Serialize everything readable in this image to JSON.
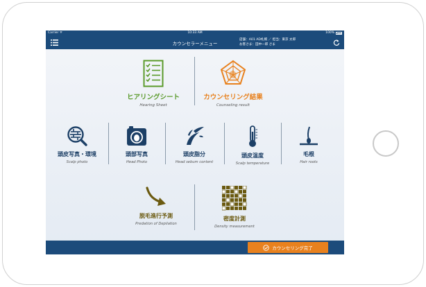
{
  "statusbar": {
    "carrier": "Carrier ᯤ",
    "time": "10:33 AM",
    "battery": "100%"
  },
  "navbar": {
    "title": "カウンセラーメニュー",
    "info_line1": "店舗：A01 AD札幌 ／ 担当：東京 太郎",
    "info_line2": "お客さま：田中一郎 さま"
  },
  "menu": {
    "hearing_sheet": {
      "jp": "ヒアリングシート",
      "en": "Hearing Sheet",
      "color": "#5a9a2a"
    },
    "counseling_result": {
      "jp": "カウンセリング結果",
      "en": "Counseling result",
      "color": "#e8811e"
    },
    "scalp_photo": {
      "jp": "頭皮写真・環境",
      "en": "Scalp photo"
    },
    "head_photo": {
      "jp": "頭部写真",
      "en": "Head Photo"
    },
    "head_sebum": {
      "jp": "頭皮脂分",
      "en": "Head sebum content"
    },
    "scalp_temperature": {
      "jp": "頭皮温度",
      "en": "Scalp temperature"
    },
    "hair_roots": {
      "jp": "毛根",
      "en": "Hair roots"
    },
    "depilation": {
      "jp": "脱毛進行予測",
      "en": "Predation of Depilation",
      "color": "#6b5a10"
    },
    "density": {
      "jp": "密度計測",
      "en": "Density measurement",
      "color": "#6b5a10"
    }
  },
  "footer": {
    "complete_label": "カウンセリング完了",
    "accent": "#e8811e"
  },
  "colors": {
    "navy": "#1c4b7b",
    "icon_blue": "#1c4b7b",
    "green": "#5a9a2a",
    "orange": "#e8811e",
    "olive": "#6b5a10"
  }
}
